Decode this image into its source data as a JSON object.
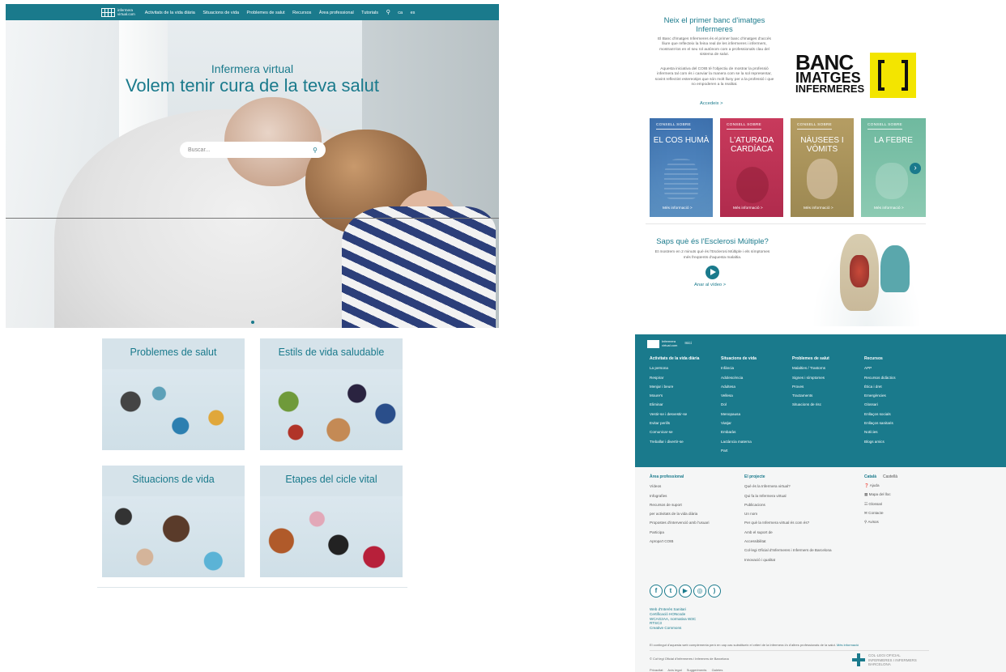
{
  "hero": {
    "logo": [
      "infermera",
      "virtual.com"
    ],
    "nav": [
      "Activitats de la vida diària",
      "Situacions de vida",
      "Problemes de salut",
      "Recursos",
      "Àrea professional",
      "Tutorials"
    ],
    "nav_icon": "search-icon",
    "langs": [
      "ca",
      "es"
    ],
    "subtitle": "Infermera virtual",
    "title": "Volem tenir cura de la teva salut",
    "search_placeholder": "Buscar..."
  },
  "tiles": [
    {
      "title": "Problemes de salut"
    },
    {
      "title": "Estils de vida saludable"
    },
    {
      "title": "Situacions de vida"
    },
    {
      "title": "Etapes del cicle vital"
    }
  ],
  "banc": {
    "heading": "Neix el primer banc d'imatges Infermeres",
    "p1": "El Banc d'imatges Infermeres és el primer banc d'imatges d'accés lliure que reflecteix la feina real de les infermeres i infermers, mostrant-los en el seu rol autònom com a professionals clau del sistema de salut.",
    "p2": "Aquesta iniciativa del COIB té l'objectiu de mostrar la professió infermera tal com és i canviar la manera com se la sol representar, sovint reflectint estereotips que són molt lluny per a la professió i que no empoderen a la realitat.",
    "link": "Accedeix >",
    "logo_lines": [
      "BANC",
      "IMATGES",
      "INFERMERES"
    ],
    "logo_color": "#f3e500"
  },
  "advice_cards": [
    {
      "tag": "CONSELL SOBRE",
      "title": "EL COS HUMÀ",
      "more": "Més informació >"
    },
    {
      "tag": "CONSELL SOBRE",
      "title": "L'ATURADA CARDÍACA",
      "more": "Més informació >"
    },
    {
      "tag": "CONSELL SOBRE",
      "title": "NÀUSEES I VÒMITS",
      "more": "Més informació >"
    },
    {
      "tag": "CONSELL SOBRE",
      "title": "LA FEBRE",
      "more": "Més informació >"
    }
  ],
  "ms": {
    "title": "Saps què és l'Esclerosi Múltiple?",
    "text": "Et mostrem en 2 minuts què és l'Esclerosi Múltiple i els símptomes més freqüents d'aquesta malaltia.",
    "link": "Anar al vídeo >"
  },
  "footer": {
    "logo": [
      "Infermera",
      "virtual.com"
    ],
    "inici": "Inici",
    "col1": {
      "heading": "Activitats de la vida diària",
      "items": [
        "La persona",
        "Respirar",
        "Menjar i beure",
        "Moure's",
        "Eliminar",
        "Vestir-se i desvestir-se",
        "Evitar perills",
        "Comunicar-se",
        "Treballar i divertir-se"
      ]
    },
    "col2": {
      "heading": "Situacions de vida",
      "items": [
        "Infància",
        "Adolescència",
        "Adultesa",
        "Vellesa",
        "Dol",
        "Menopausa",
        "Viatjar",
        "Embaràs",
        "Lactància materna",
        "Part"
      ]
    },
    "col3": {
      "heading": "Problemes de salut",
      "items": [
        "Malalties / Trastorns",
        "Signes i símptomes",
        "Proves",
        "Tractaments",
        "Situacions de risc"
      ]
    },
    "col4": {
      "heading": "Recursos",
      "items": [
        "APP",
        "Recursos didàctics",
        "Ètica i dret",
        "Emergències",
        "Glossari",
        "Enllaços socials",
        "Enllaços sanitaris",
        "Notícies",
        "Blogs amics"
      ]
    },
    "col5": {
      "heading": "Àrea professional",
      "items": [
        "Vídeos",
        "Infografies",
        "Recursos de suport",
        "per activitats de la vida diària",
        "Propostes d'intervenció amb l'usuari",
        "Participa",
        "Apropa't COIB"
      ]
    },
    "col6": {
      "heading": "El projecte",
      "items": [
        "Què és la Infermera virtual?",
        "Qui fa la Infermera virtual",
        "Publicacions",
        "Un nom",
        "Per què la Infermera virtual és com és?",
        "Amb el suport de",
        "Accessibilitat",
        "Col·legi Oficial d'Infermeres i Infermers de Barcelona",
        "Innovació i qualitat"
      ]
    },
    "lang_active": "Català",
    "lang_other": "Castellà",
    "col7": {
      "items": [
        "Ajuda",
        "Mapa del lloc",
        "Glossari",
        "Contacte",
        "Avisos"
      ]
    },
    "col7_icons": [
      "help-icon",
      "map-icon",
      "glossary-icon",
      "contact-icon",
      "search-icon"
    ],
    "social_icons": [
      "facebook-icon",
      "twitter-icon",
      "youtube-icon",
      "instagram-icon",
      "rss-icon"
    ],
    "links": [
      "Web d'Interès Sanitari",
      "Certificació HONcode",
      "WCAG2AA, normativa W3C",
      "RTSC3",
      "Creative Commons"
    ],
    "note": "El contingut d'aquesta web complementa però en cap cas substitueix el criteri de la Infermera i/o d'altres professionals de la salut.",
    "note_link": "Més informació",
    "copyright": "© Col·legi Oficial d'Infermeres i Infermers de Barcelona",
    "legal": [
      "Privacitat",
      "Avís legal",
      "Suggeriments",
      "Galetes"
    ],
    "coib": [
      "COL·LEGI OFICIAL",
      "INFERMERES I INFERMERS",
      "BARCELONA"
    ],
    "brand_color": "#1a7a8c"
  }
}
